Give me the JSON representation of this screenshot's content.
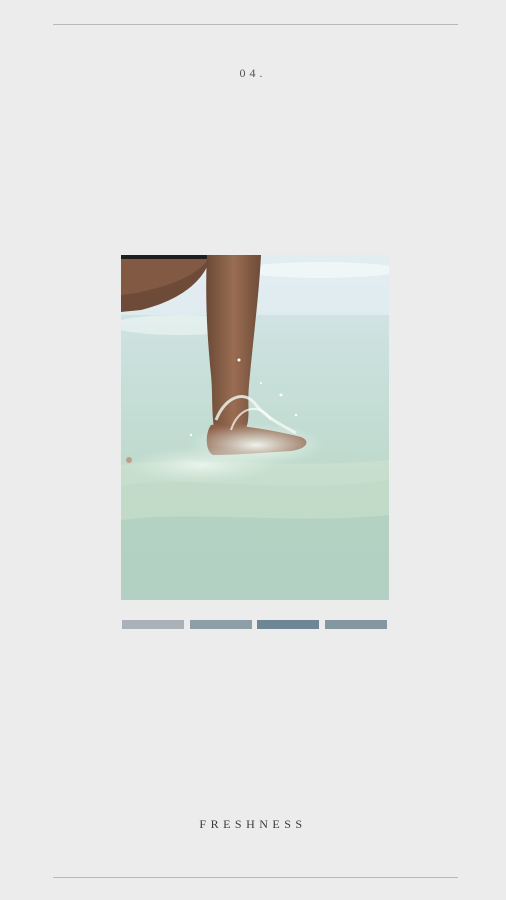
{
  "slide": {
    "number": "04.",
    "caption": "FRESHNESS"
  },
  "photo": {
    "subject": "foot-splashing-in-shallow-sea-water-icon"
  },
  "palette": [
    {
      "color": "#aab1b8"
    },
    {
      "color": "#8e9ea6"
    },
    {
      "color": "#6f8695"
    },
    {
      "color": "#84969f"
    }
  ]
}
